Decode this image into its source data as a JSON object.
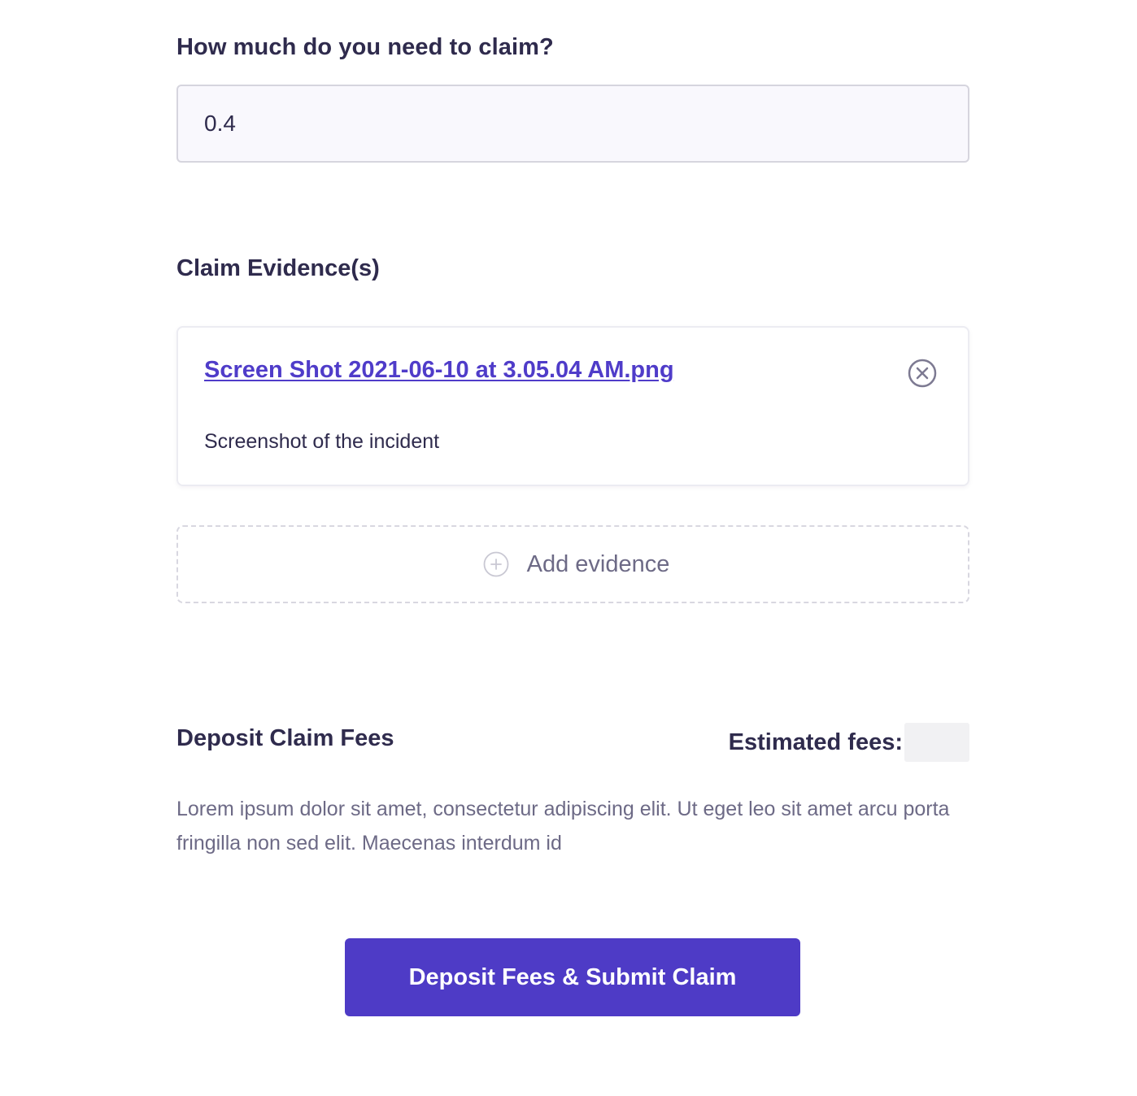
{
  "claim_amount": {
    "label": "How much do you need to claim?",
    "value": "0.4"
  },
  "evidence": {
    "title": "Claim Evidence(s)",
    "items": [
      {
        "file_name": "Screen Shot 2021-06-10 at 3.05.04 AM.png",
        "description": "Screenshot of the incident",
        "remove_icon": "close-circle-icon"
      }
    ],
    "add_label": "Add evidence",
    "add_icon": "plus-circle-icon"
  },
  "fees": {
    "title": "Deposit Claim Fees",
    "estimated_label": "Estimated fees:",
    "estimated_value": "",
    "description": "Lorem ipsum dolor sit amet, consectetur adipiscing elit. Ut eget leo sit amet arcu porta fringilla non sed elit. Maecenas interdum id"
  },
  "submit": {
    "label": "Deposit Fees & Submit Claim"
  },
  "colors": {
    "accent": "#4e3bc6",
    "link": "#4f3cc9",
    "text": "#2f2b4d",
    "muted": "#6d6a86",
    "input_bg": "#f9f8fd"
  }
}
